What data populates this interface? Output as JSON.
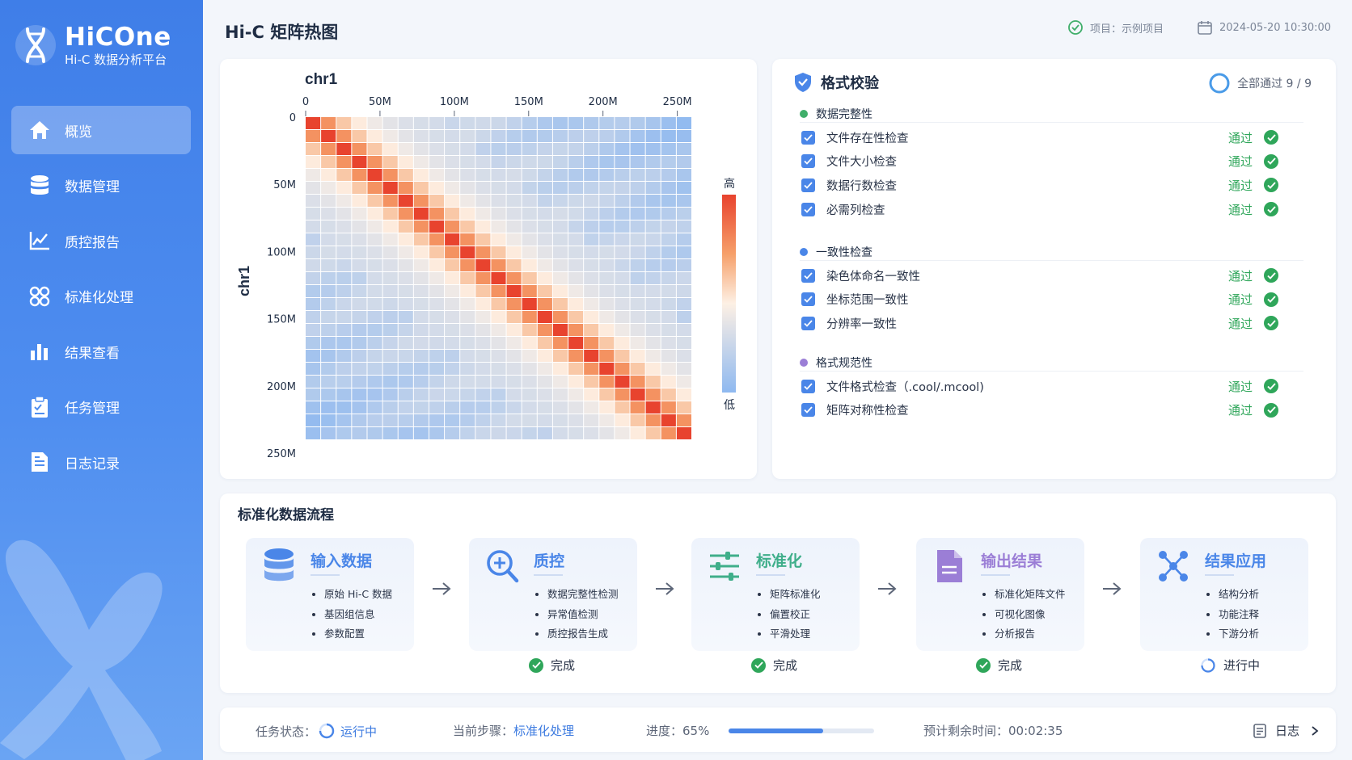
{
  "app": {
    "name": "HiCOne",
    "subtitle": "Hi-C 数据分析平台"
  },
  "sidebar": {
    "items": [
      {
        "label": "概览",
        "icon": "home-icon",
        "active": true
      },
      {
        "label": "数据管理",
        "icon": "database-icon",
        "active": false
      },
      {
        "label": "质控报告",
        "icon": "chart-line-icon",
        "active": false
      },
      {
        "label": "标准化处理",
        "icon": "molecule-icon",
        "active": false
      },
      {
        "label": "结果查看",
        "icon": "bar-chart-icon",
        "active": false
      },
      {
        "label": "任务管理",
        "icon": "clipboard-icon",
        "active": false
      },
      {
        "label": "日志记录",
        "icon": "document-icon",
        "active": false
      }
    ]
  },
  "header": {
    "title": "Hi-C 矩阵热图",
    "project": "项目：示例项目",
    "datetime": "2024-05-20 10:30:00"
  },
  "heatmap": {
    "chrom_label": "chr1",
    "ylabel": "chr1",
    "x_ticks": [
      "0",
      "50M",
      "100M",
      "150M",
      "200M",
      "250M"
    ],
    "y_ticks": [
      "0",
      "50M",
      "100M",
      "150M",
      "200M",
      "250M"
    ],
    "legend_high": "高",
    "legend_low": "低",
    "colors": {
      "high": "#e8432e",
      "mid": "#fdf0e4",
      "low": "#8fb9f0"
    }
  },
  "validation": {
    "title": "格式校验",
    "summary": "全部通过 9 / 9",
    "groups": [
      {
        "name": "数据完整性",
        "color": "#3fae6a",
        "items": [
          "文件存在性检查",
          "文件大小检查",
          "数据行数检查",
          "必需列检查"
        ]
      },
      {
        "name": "一致性检查",
        "color": "#4a86e8",
        "items": [
          "染色体命名一致性",
          "坐标范围一致性",
          "分辨率一致性"
        ]
      },
      {
        "name": "格式规范性",
        "color": "#9b7ed6",
        "items": [
          "文件格式检查（.cool/.mcool)",
          "矩阵对称性检查"
        ]
      }
    ],
    "pass_label": "通过"
  },
  "flow": {
    "title": "标准化数据流程",
    "steps": [
      {
        "name": "输入数据",
        "color": "#4a86e8",
        "icon": "database-icon",
        "items": [
          "原始 Hi-C 数据",
          "基因组信息",
          "参数配置"
        ],
        "status": ""
      },
      {
        "name": "质控",
        "color": "#4a86e8",
        "icon": "magnify-plus-icon",
        "items": [
          "数据完整性检测",
          "异常值检测",
          "质控报告生成"
        ],
        "status": "完成"
      },
      {
        "name": "标准化",
        "color": "#3fae8a",
        "icon": "sliders-icon",
        "items": [
          "矩阵标准化",
          "偏置校正",
          "平滑处理"
        ],
        "status": "完成"
      },
      {
        "name": "输出结果",
        "color": "#9b7ed6",
        "icon": "file-icon",
        "items": [
          "标准化矩阵文件",
          "可视化图像",
          "分析报告"
        ],
        "status": "完成"
      },
      {
        "name": "结果应用",
        "color": "#4a86e8",
        "icon": "network-icon",
        "items": [
          "结构分析",
          "功能注释",
          "下游分析"
        ],
        "status": "进行中"
      }
    ]
  },
  "status_bar": {
    "task_label": "任务状态：",
    "task_value": "运行中",
    "step_label": "当前步骤：",
    "step_value": "标准化处理",
    "progress_label": "进度：",
    "progress_value": "65%",
    "progress": 0.65,
    "eta_label": "预计剩余时间：",
    "eta_value": "00:02:35",
    "log_label": "日志"
  }
}
